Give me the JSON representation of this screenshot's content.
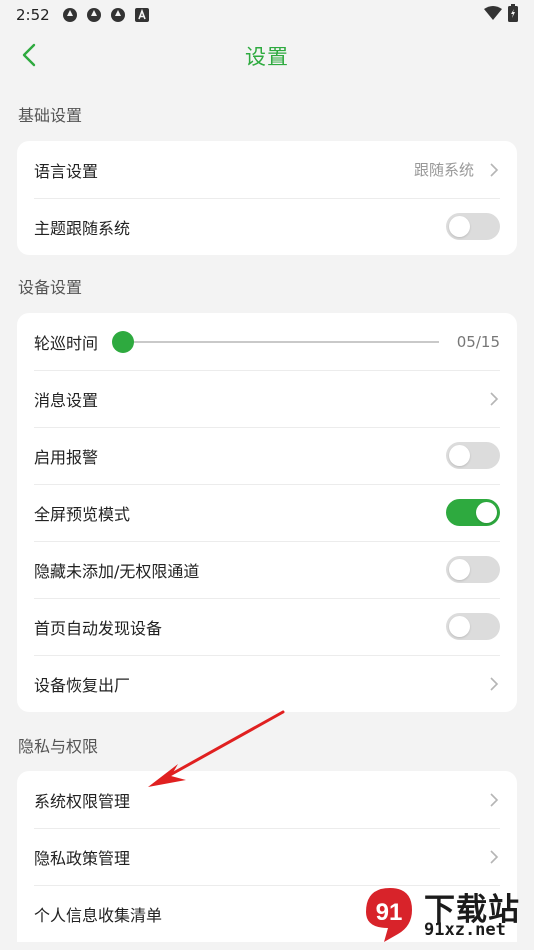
{
  "status_bar": {
    "time": "2:52",
    "icons": [
      "app-icon",
      "app-icon",
      "app-icon",
      "a-box-icon"
    ],
    "right_icons": [
      "wifi-icon",
      "battery-icon"
    ]
  },
  "header": {
    "title": "设置",
    "back_icon": "back-chevron-icon"
  },
  "sections": {
    "basic": {
      "title": "基础设置",
      "language": {
        "label": "语言设置",
        "value": "跟随系统"
      },
      "theme": {
        "label": "主题跟随系统",
        "enabled": false
      }
    },
    "device": {
      "title": "设备设置",
      "patrol": {
        "label": "轮巡时间",
        "value": "05/15",
        "level": 0
      },
      "message": {
        "label": "消息设置"
      },
      "alarm": {
        "label": "启用报警",
        "enabled": false
      },
      "fullscreen": {
        "label": "全屏预览模式",
        "enabled": true
      },
      "hide_channels": {
        "label": "隐藏未添加/无权限通道",
        "enabled": false
      },
      "auto_discover": {
        "label": "首页自动发现设备",
        "enabled": false
      },
      "factory_reset": {
        "label": "设备恢复出厂"
      }
    },
    "privacy": {
      "title": "隐私与权限",
      "system_permissions": {
        "label": "系统权限管理"
      },
      "privacy_policy": {
        "label": "隐私政策管理"
      },
      "personal_info": {
        "label": "个人信息收集清单"
      }
    }
  },
  "colors": {
    "accent": "#2eaa3f",
    "toggle_off": "#dcdcdc",
    "background": "#f3f3f3",
    "arrow": "#e02020"
  },
  "watermark": {
    "text": "下载站",
    "url": "91xz.net"
  }
}
